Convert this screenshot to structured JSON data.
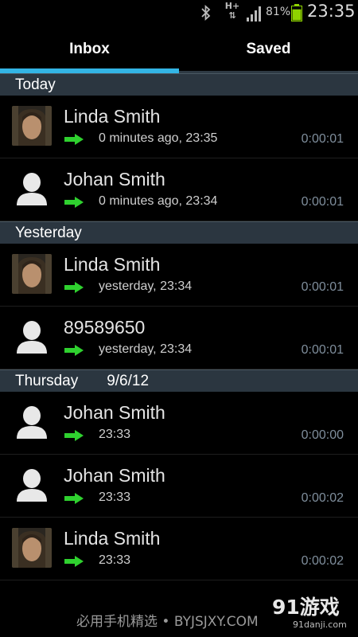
{
  "status_bar": {
    "network": "H+",
    "battery_percent": "81%",
    "battery_level": 0.81,
    "time": "23:35",
    "icons": [
      "bluetooth-icon",
      "hplus-data-icon",
      "signal-icon",
      "battery-icon"
    ]
  },
  "tabs": [
    {
      "label": "Inbox",
      "active": true
    },
    {
      "label": "Saved",
      "active": false
    }
  ],
  "sections": [
    {
      "label": "Today",
      "date": "",
      "rows": [
        {
          "name": "Linda Smith",
          "time": "0 minutes ago, 23:35",
          "duration": "0:00:01",
          "avatar": "photo"
        },
        {
          "name": "Johan Smith",
          "time": "0 minutes ago, 23:34",
          "duration": "0:00:01",
          "avatar": "placeholder"
        }
      ]
    },
    {
      "label": "Yesterday",
      "date": "",
      "rows": [
        {
          "name": "Linda Smith",
          "time": "yesterday, 23:34",
          "duration": "0:00:01",
          "avatar": "photo"
        },
        {
          "name": "89589650",
          "time": "yesterday, 23:34",
          "duration": "0:00:01",
          "avatar": "placeholder"
        }
      ]
    },
    {
      "label": "Thursday",
      "date": "9/6/12",
      "rows": [
        {
          "name": "Johan Smith",
          "time": "23:33",
          "duration": "0:00:00",
          "avatar": "placeholder"
        },
        {
          "name": "Johan Smith",
          "time": "23:33",
          "duration": "0:00:02",
          "avatar": "placeholder"
        },
        {
          "name": "Linda Smith",
          "time": "23:33",
          "duration": "0:00:02",
          "avatar": "photo"
        }
      ]
    }
  ],
  "colors": {
    "tab_indicator": "#33b5e5",
    "section_bg": "#2b3640",
    "arrow": "#2fd12f",
    "duration_text": "#7f8e9c"
  },
  "watermark": {
    "text": "必用手机精选 • BYJSJXY.COM",
    "logo_main": "91游戏",
    "logo_sub": "91danji.com"
  }
}
